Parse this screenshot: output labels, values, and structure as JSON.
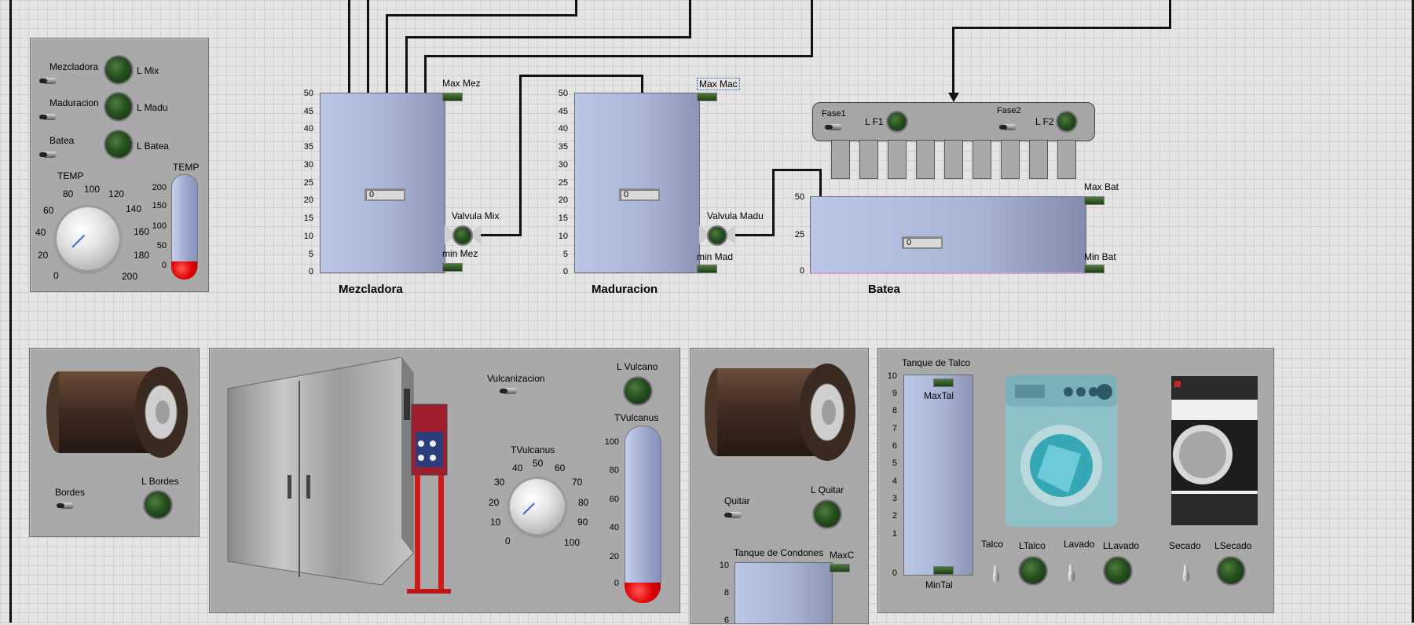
{
  "top_controls": {
    "switches": [
      {
        "label": "Mezcladora",
        "led": "L Mix"
      },
      {
        "label": "Maduracion",
        "led": "L Madu"
      },
      {
        "label": "Batea",
        "led": "L Batea"
      }
    ],
    "temp_knob_label": "TEMP",
    "temp_knob_ticks": [
      "0",
      "20",
      "40",
      "60",
      "80",
      "100",
      "120",
      "140",
      "160",
      "180",
      "200"
    ],
    "temp_therm_label": "TEMP",
    "temp_therm_ticks": [
      "200",
      "150",
      "100",
      "50",
      "0"
    ],
    "temp_therm_level": 0
  },
  "tank_ticks_50": [
    "50",
    "45",
    "40",
    "35",
    "30",
    "25",
    "20",
    "15",
    "10",
    "5",
    "0"
  ],
  "mezcladora": {
    "title": "Mezcladora",
    "value": "0",
    "max": "Max Mez",
    "min": "min Mez",
    "valve": "Valvula Mix"
  },
  "maduracion": {
    "title": "Maduracion",
    "value": "0",
    "max": "Max Mac",
    "min": "min Mad",
    "valve": "Valvula Madu"
  },
  "batea": {
    "title": "Batea",
    "value": "0",
    "max": "Max Bat",
    "min": "Min Bat",
    "ticks": [
      "50",
      "25",
      "0"
    ]
  },
  "phases": {
    "fase1": "Fase1",
    "lf1": "L F1",
    "fase2": "Fase2",
    "lf2": "L F2"
  },
  "bordes": {
    "switch": "Bordes",
    "led": "L Bordes"
  },
  "vulcano": {
    "switch": "Vulcanizacion",
    "led": "L Vulcano",
    "knob_label": "TVulcanus",
    "knob_ticks": [
      "0",
      "10",
      "20",
      "30",
      "40",
      "50",
      "60",
      "70",
      "80",
      "90",
      "100"
    ],
    "therm_label": "TVulcanus",
    "therm_ticks": [
      "100",
      "80",
      "60",
      "40",
      "20",
      "0"
    ],
    "therm_level": 0
  },
  "quitar": {
    "switch": "Quitar",
    "led": "L Quitar",
    "tank_label": "Tanque de Condones",
    "max": "MaxC",
    "ticks": [
      "10",
      "8",
      "6"
    ]
  },
  "talco": {
    "tank_label": "Tanque de Talco",
    "ticks": [
      "10",
      "9",
      "8",
      "7",
      "6",
      "5",
      "4",
      "3",
      "2",
      "1",
      "0"
    ],
    "max": "MaxTal",
    "min": "MinTal",
    "talco": "Talco",
    "ltalco": "LTalco",
    "lavado": "Lavado",
    "llavado": "LLavado",
    "secado": "Secado",
    "lsecado": "LSecado"
  }
}
